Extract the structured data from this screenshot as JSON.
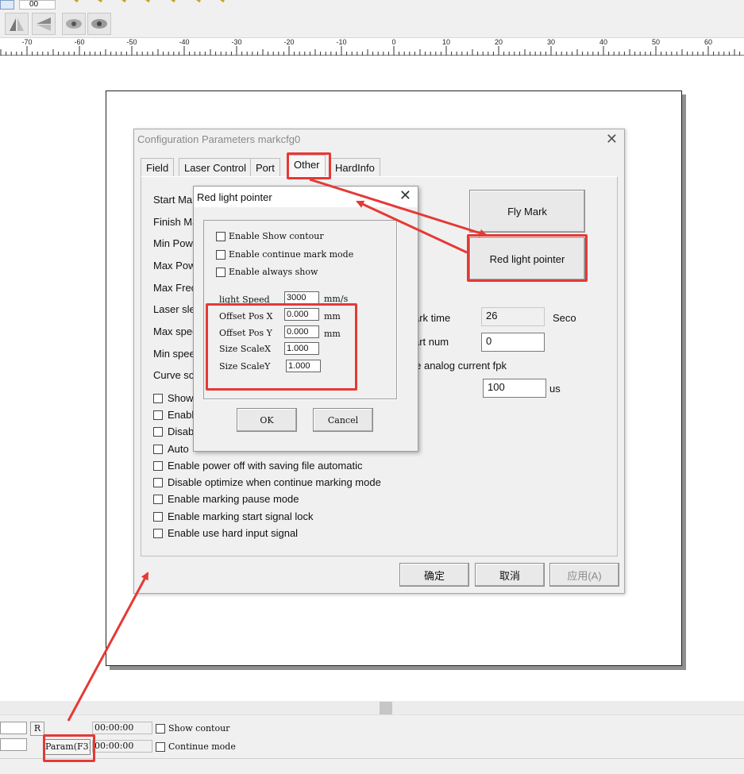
{
  "toolbar": {
    "partial_tab_label": "00",
    "icons": [
      "mirror-horizontal-icon",
      "mirror-vertical-icon",
      "show-eye-icon",
      "hide-eye-icon"
    ]
  },
  "ruler": {
    "ticks": [
      "-70",
      "-60",
      "-50",
      "-40",
      "-30",
      "-20",
      "-10",
      "0",
      "10",
      "20",
      "30",
      "40",
      "50",
      "60"
    ]
  },
  "config_window": {
    "title": "Configuration Parameters markcfg0",
    "tabs": [
      "Field",
      "Laser Control",
      "Port",
      "Other",
      "HardInfo"
    ],
    "active_tab": "Other",
    "left_labels": [
      "Start Ma",
      "Finish Ma",
      "Min Pow",
      "Max Pow",
      "Max Frec",
      "Laser sle",
      "Max spee",
      "Min spee",
      "Curve sc"
    ],
    "checkboxes_partial": [
      "Show",
      "Enable",
      "Disab",
      "Auto"
    ],
    "checkboxes": [
      "Enable power off with saving file automatic",
      "Disable optimize when continue marking mode",
      "Enable marking pause mode",
      "Enable marking start signal lock",
      "Enable use hard input signal"
    ],
    "fly_mark_button": "Fly Mark",
    "red_light_button": "Red light pointer",
    "mark_time_label": "ark time",
    "mark_time_value": "26",
    "mark_time_unit": "Seco",
    "start_num_label": "art num",
    "start_num_value": "0",
    "analog_label": "ble analog current fpk",
    "analog_value": "100",
    "analog_unit": "us",
    "ok_button": "确定",
    "cancel_button": "取消",
    "apply_button": "应用(A)"
  },
  "red_light_dialog": {
    "title": "Red light pointer",
    "checkboxes": [
      "Enable Show contour",
      "Enable continue mark mode",
      "Enable always show"
    ],
    "light_speed_label": "light Speed",
    "light_speed_value": "3000",
    "light_speed_unit": "mm/s",
    "offset_x_label": "Offset Pos X",
    "offset_x_value": "0.000",
    "offset_y_label": "Offset Pos Y",
    "offset_y_value": "0.000",
    "offset_unit": "mm",
    "scale_x_label": "Size ScaleX",
    "scale_x_value": "1.000",
    "scale_y_label": "Size ScaleY",
    "scale_y_value": "1.000",
    "ok": "OK",
    "cancel": "Cancel"
  },
  "status_bar": {
    "r_button": "R",
    "param_button": "Param(F3)",
    "time1": "00:00:00",
    "time2": "00:00:00",
    "show_contour": "Show contour",
    "continue_mode": "Continue mode"
  },
  "colors": {
    "annotation_red": "#e53935",
    "dialog_bg": "#f0f0f0"
  }
}
